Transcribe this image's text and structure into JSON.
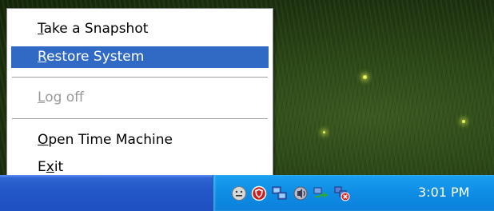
{
  "context_menu": {
    "items": [
      {
        "prefix": "",
        "mnemonic": "T",
        "rest": "ake a Snapshot",
        "state": "normal"
      },
      {
        "prefix": "",
        "mnemonic": "R",
        "rest": "estore System",
        "state": "highlighted"
      },
      {
        "prefix": "",
        "mnemonic": "L",
        "rest": "og off",
        "state": "disabled"
      },
      {
        "prefix": "",
        "mnemonic": "O",
        "rest": "pen Time Machine",
        "state": "normal"
      },
      {
        "prefix": "E",
        "mnemonic": "x",
        "rest": "it",
        "state": "normal"
      }
    ]
  },
  "taskbar": {
    "clock": "3:01 PM",
    "tray_icons": [
      "smiley-face-icon",
      "red-shield-icon",
      "network-computers-icon",
      "volume-speaker-icon",
      "connection-transfer-icon",
      "network-disconnected-icon"
    ]
  },
  "colors": {
    "menu_highlight": "#316ac5",
    "taskbar_blue": "#2457c8",
    "tray_blue": "#0f8ee6",
    "disabled_text": "#9a9a9a"
  }
}
